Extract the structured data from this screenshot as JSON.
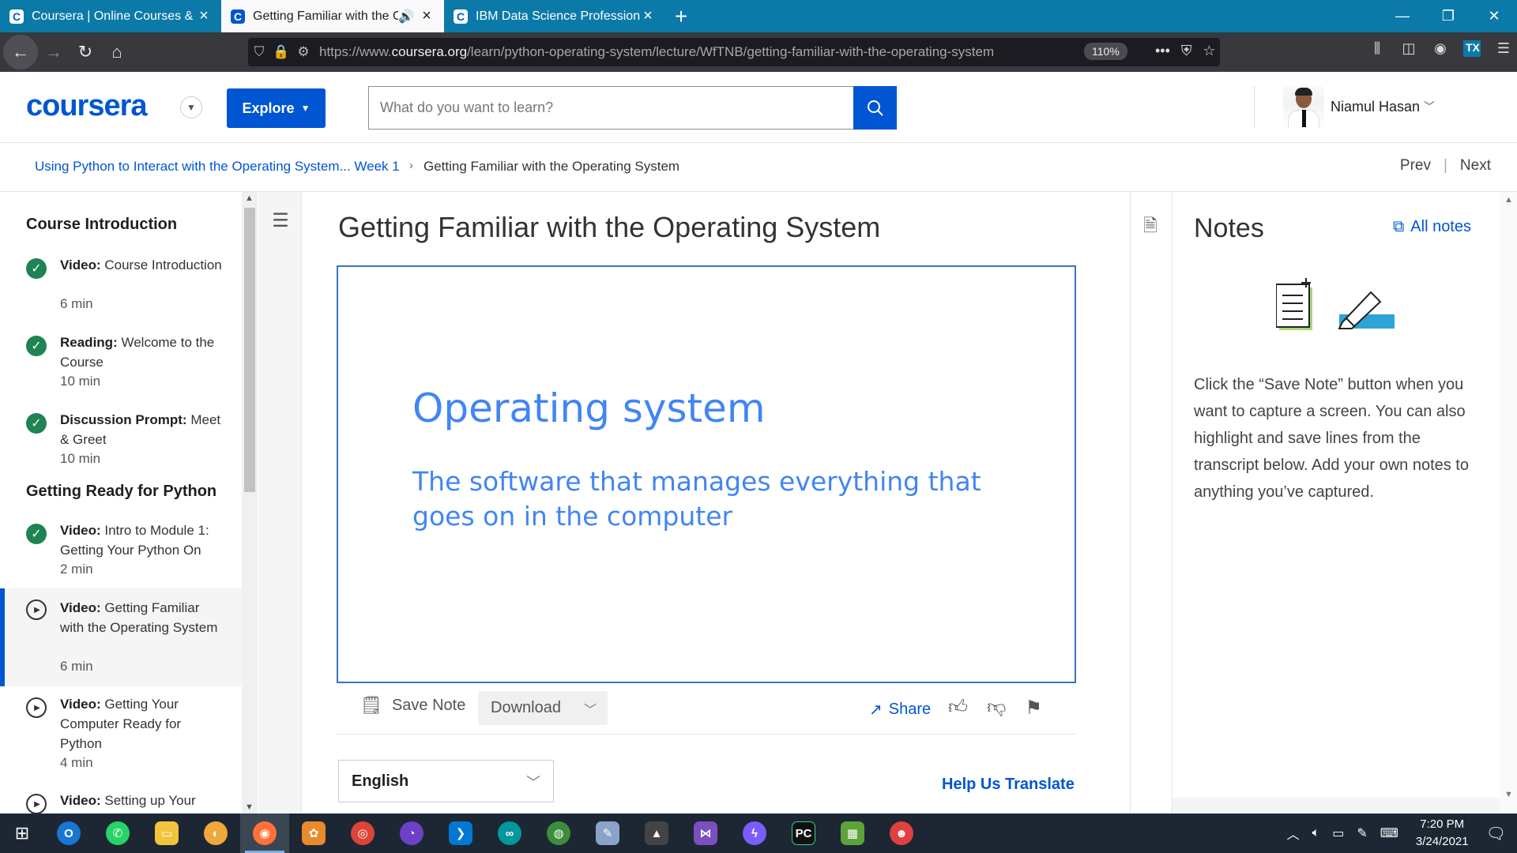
{
  "browser": {
    "tabs": [
      {
        "title": "Coursera | Online Courses & Cr",
        "active": false,
        "favicon": "C"
      },
      {
        "title": "Getting Familiar with the Op",
        "active": true,
        "favicon": "C"
      },
      {
        "title": "IBM Data Science Professional",
        "active": false,
        "favicon": "C"
      }
    ],
    "url_prefix": "https://www.",
    "url_domain": "coursera.org",
    "url_path": "/learn/python-operating-system/lecture/WfTNB/getting-familiar-with-the-operating-system",
    "zoom": "110%"
  },
  "header": {
    "logo": "coursera",
    "explore_label": "Explore",
    "search_placeholder": "What do you want to learn?",
    "user_name": "Niamul Hasan"
  },
  "breadcrumb": {
    "course": "Using Python to Interact with the Operating System... Week 1",
    "current": "Getting Familiar with the Operating System",
    "prev": "Prev",
    "next": "Next"
  },
  "sidebar": {
    "sections": [
      {
        "title": "Course Introduction",
        "items": [
          {
            "type": "Video:",
            "title": "Course Introduction",
            "duration": "6 min",
            "done": true
          },
          {
            "type": "Reading:",
            "title": "Welcome to the Course",
            "duration": "10 min",
            "done": true
          },
          {
            "type": "Discussion Prompt:",
            "title": "Meet & Greet",
            "duration": "10 min",
            "done": true
          }
        ]
      },
      {
        "title": "Getting Ready for Python",
        "items": [
          {
            "type": "Video:",
            "title": "Intro to Module 1: Getting Your Python On",
            "duration": "2 min",
            "done": true
          },
          {
            "type": "Video:",
            "title": "Getting Familiar with the Operating System",
            "duration": "6 min",
            "done": false,
            "active": true
          },
          {
            "type": "Video:",
            "title": "Getting Your Computer Ready for Python",
            "duration": "4 min",
            "done": false
          },
          {
            "type": "Video:",
            "title": "Setting up Your",
            "duration": "",
            "done": false
          }
        ]
      }
    ]
  },
  "main": {
    "title": "Getting Familiar with the Operating System",
    "slide_title": "Operating system",
    "slide_subtitle": "The software that manages everything that goes on in the computer",
    "save_note": "Save Note",
    "download": "Download",
    "share": "Share",
    "language": "English",
    "help_translate": "Help Us Translate"
  },
  "notes": {
    "title": "Notes",
    "all_notes": "All notes",
    "description": "Click the “Save Note” button when you want to capture a screen. You can also highlight and save lines from the transcript below. Add your own notes to anything you’ve captured."
  },
  "taskbar": {
    "time": "7:20 PM",
    "date": "3/24/2021"
  },
  "colors": {
    "accent": "#0056d2",
    "success": "#1f8354",
    "slide_text": "#4285f4"
  }
}
